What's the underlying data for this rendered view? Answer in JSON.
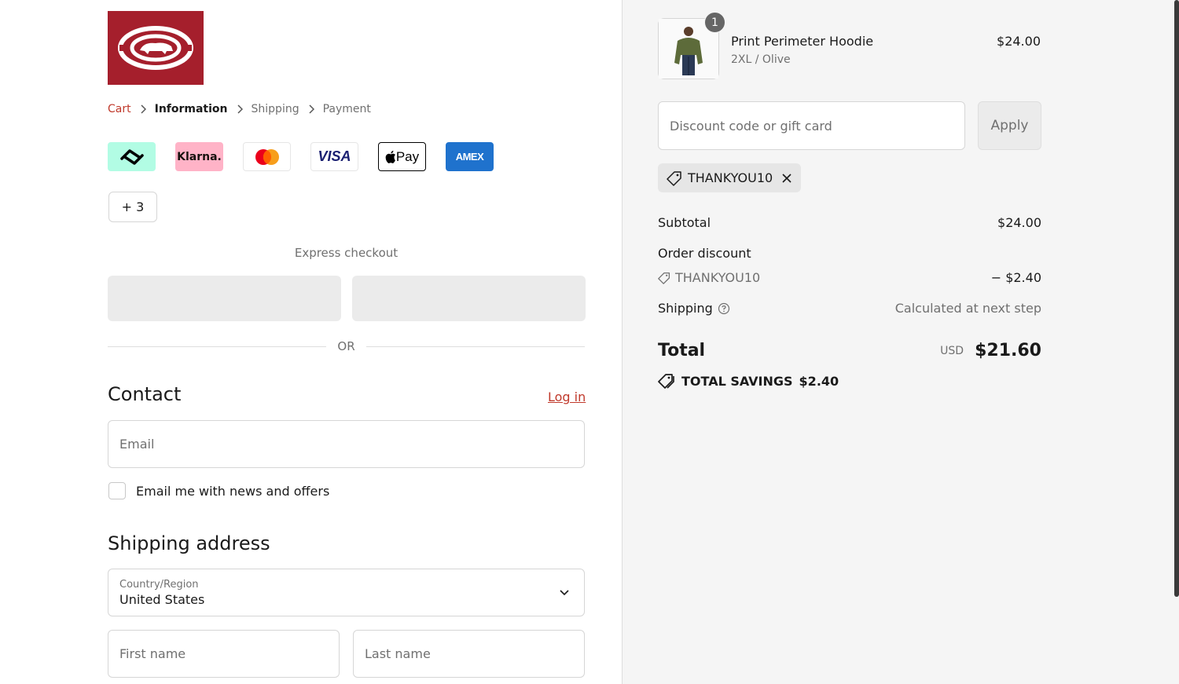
{
  "breadcrumb": {
    "cart": "Cart",
    "information": "Information",
    "shipping": "Shipping",
    "payment": "Payment"
  },
  "payment_methods": {
    "afterpay": "afterpay-icon",
    "klarna": "Klarna.",
    "mastercard": "mastercard-icon",
    "visa": "VISA",
    "applepay": "Pay",
    "amex": "AMEX",
    "more": "+ 3"
  },
  "express": {
    "title": "Express checkout",
    "or": "OR"
  },
  "contact": {
    "title": "Contact",
    "login": "Log in",
    "email_placeholder": "Email",
    "newsletter_label": "Email me with news and offers"
  },
  "shipping_address": {
    "title": "Shipping address",
    "country_label": "Country/Region",
    "country_value": "United States",
    "first_name_placeholder": "First name",
    "last_name_placeholder": "Last name"
  },
  "order": {
    "quantity": "1",
    "product_name": "Print Perimeter Hoodie",
    "product_variant": "2XL / Olive",
    "product_price": "$24.00",
    "discount_placeholder": "Discount code or gift card",
    "apply": "Apply",
    "applied_code": "THANKYOU10",
    "subtotal_label": "Subtotal",
    "subtotal_value": "$24.00",
    "order_discount_label": "Order discount",
    "discount_code": "THANKYOU10",
    "discount_value": "− $2.40",
    "shipping_label": "Shipping",
    "shipping_value": "Calculated at next step",
    "total_label": "Total",
    "total_currency": "USD",
    "total_value": "$21.60",
    "savings_label": "TOTAL SAVINGS",
    "savings_value": "$2.40"
  },
  "colors": {
    "brand_red": "#a51f2c",
    "link_red": "#c0392b",
    "sidebar_bg": "#f5f5f5"
  }
}
